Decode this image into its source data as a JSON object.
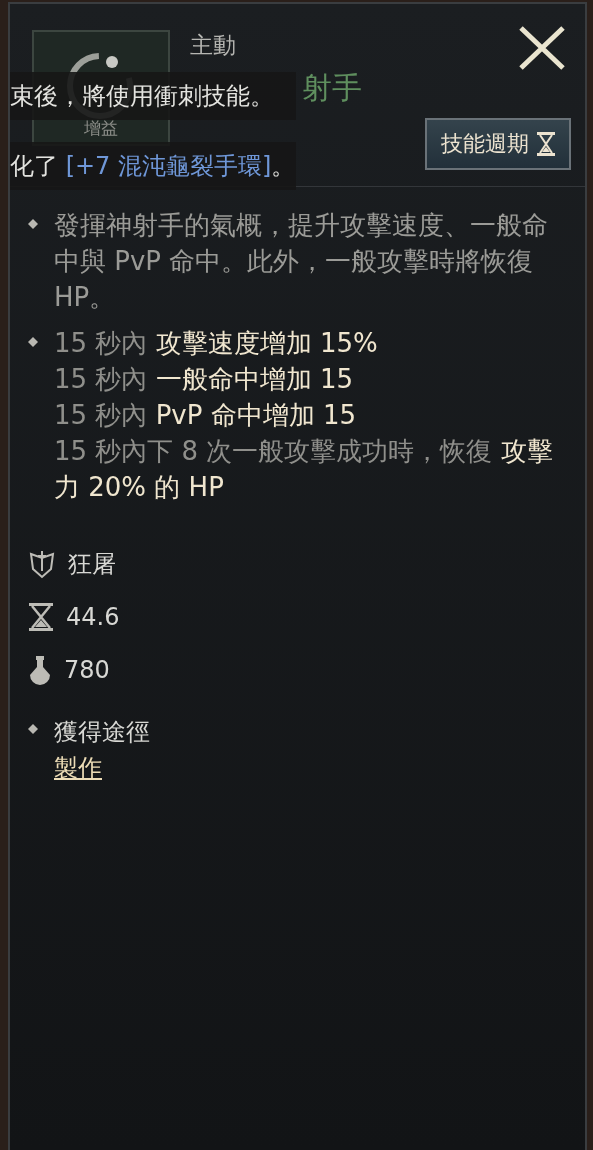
{
  "header": {
    "type": "主動",
    "title": "射手",
    "icon_label": "增益",
    "cycle_button": "技能週期"
  },
  "overlay": {
    "line_1": "束後，將使用衝刺技能。",
    "line_2": [
      {
        "kind": "plain",
        "text": "化了 "
      },
      {
        "kind": "item",
        "text": "[+7 混沌龜裂手環]"
      },
      {
        "kind": "plain",
        "text": "。"
      }
    ]
  },
  "description": "發揮神射手的氣概，提升攻擊速度、一般命中與 PvP 命中。此外，一般攻擊時將恢復 HP。",
  "effects": [
    [
      {
        "text": "15 秒內 ",
        "highlight": false
      },
      {
        "text": "攻擊速度增加 15%",
        "highlight": true
      }
    ],
    [
      {
        "text": "15 秒內 ",
        "highlight": false
      },
      {
        "text": "一般命中增加 15",
        "highlight": true
      }
    ],
    [
      {
        "text": "15 秒內 ",
        "highlight": false
      },
      {
        "text": " PvP 命中增加 15",
        "highlight": true
      }
    ],
    [
      {
        "text": "15 秒內下 8 次一般攻擊成功時，恢復 ",
        "highlight": false
      },
      {
        "text": "攻擊力 20% 的 HP",
        "highlight": true
      }
    ]
  ],
  "stats": [
    {
      "kind": "class",
      "text": "狂屠"
    },
    {
      "kind": "cooldown",
      "text": "44.6"
    },
    {
      "kind": "cost",
      "text": "780"
    }
  ],
  "source": {
    "label": "獲得途徑",
    "link": "製作"
  }
}
